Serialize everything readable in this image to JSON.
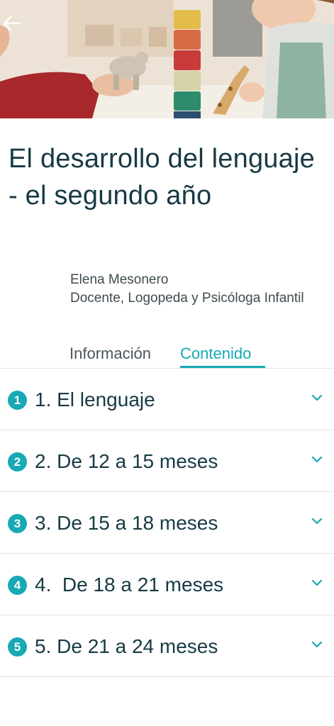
{
  "course": {
    "title": "El desarrollo del lenguaje - el segundo año"
  },
  "author": {
    "name": "Elena Mesonero",
    "role": "Docente, Logopeda y Psicóloga Infantil"
  },
  "tabs": [
    {
      "label": "Información",
      "active": false
    },
    {
      "label": "Contenido",
      "active": true
    }
  ],
  "sections": [
    {
      "badge": "1",
      "label": "1. El lenguaje"
    },
    {
      "badge": "2",
      "label": "2. De 12 a 15 meses"
    },
    {
      "badge": "3",
      "label": "3. De 15 a 18 meses"
    },
    {
      "badge": "4",
      "label": "4.  De 18 a 21 meses"
    },
    {
      "badge": "5",
      "label": "5. De 21 a 24 meses"
    }
  ],
  "icons": {
    "back": "arrow-left-icon",
    "expand": "chevron-down-icon"
  },
  "colors": {
    "accent": "#17a9b4",
    "title": "#173a44",
    "text": "#3f4b50"
  }
}
